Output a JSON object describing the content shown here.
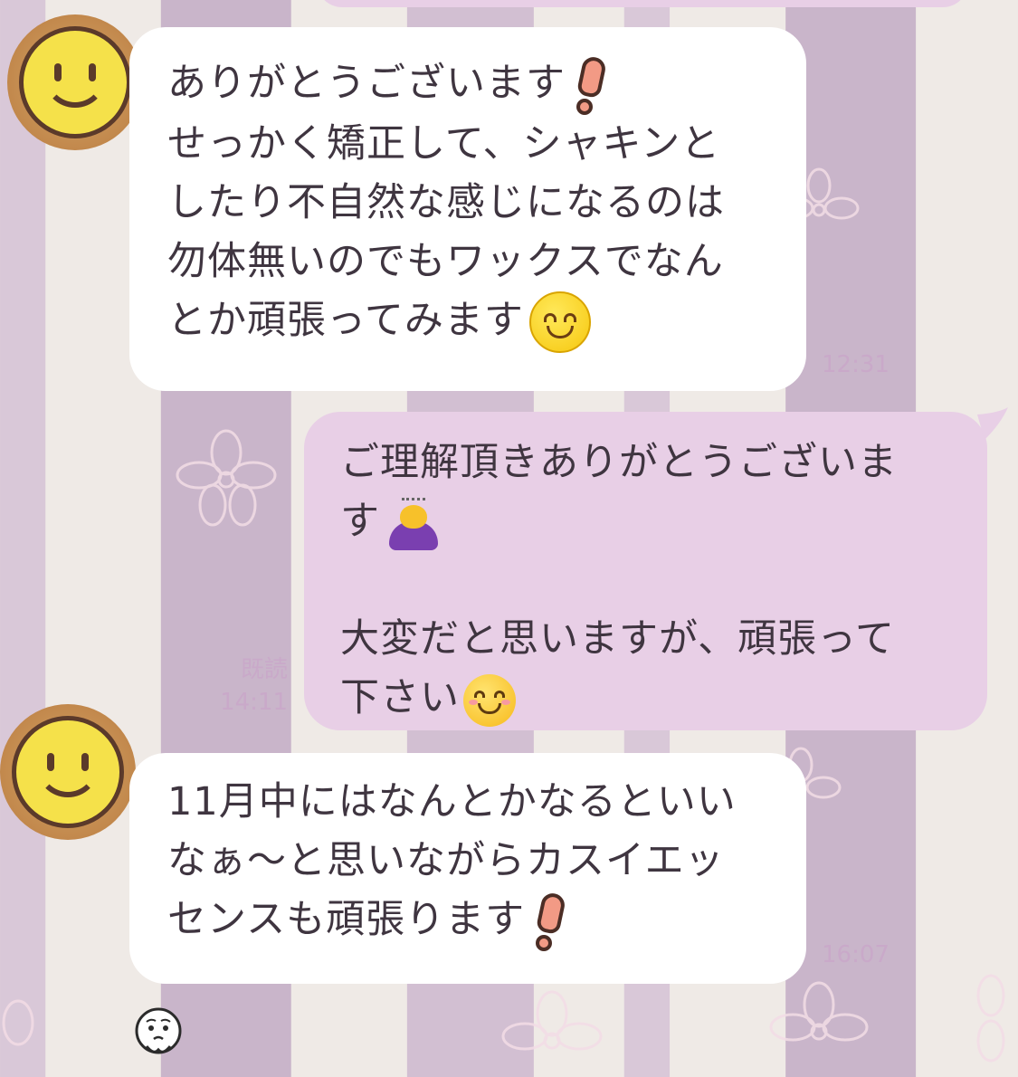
{
  "messages": [
    {
      "side": "incoming",
      "lines": [
        "ありがとうございます",
        "せっかく矯正して、シャキンと",
        "したり不自然な感じになるのは",
        "勿体無いのでもワックスでなん",
        "とか頑張ってみます"
      ],
      "time": "12:31"
    },
    {
      "side": "outgoing",
      "lines": [
        "ご理解頂きありがとうございま",
        "す",
        "",
        "大変だと思いますが、頑張って",
        "下さい"
      ],
      "read_label": "既読",
      "time": "14:11"
    },
    {
      "side": "incoming",
      "lines": [
        "11月中にはなんとかなるといい",
        "なぁ〜と思いながらカスイエッ",
        "センスも頑張ります"
      ],
      "time": "16:07"
    }
  ],
  "colors": {
    "incoming_bubble": "#ffffff",
    "outgoing_bubble": "#e8cfe6",
    "text": "#3f3540",
    "timestamp": "#c9a9c9"
  },
  "icons": {
    "avatar": "smiley-avatar-icon",
    "exclamation": "exclamation-emoji-icon",
    "smile": "smiling-face-emoji-icon",
    "blush": "blushing-face-emoji-icon",
    "bow": "person-bowing-emoji-icon",
    "sticker": "crying-face-sticker-icon"
  }
}
